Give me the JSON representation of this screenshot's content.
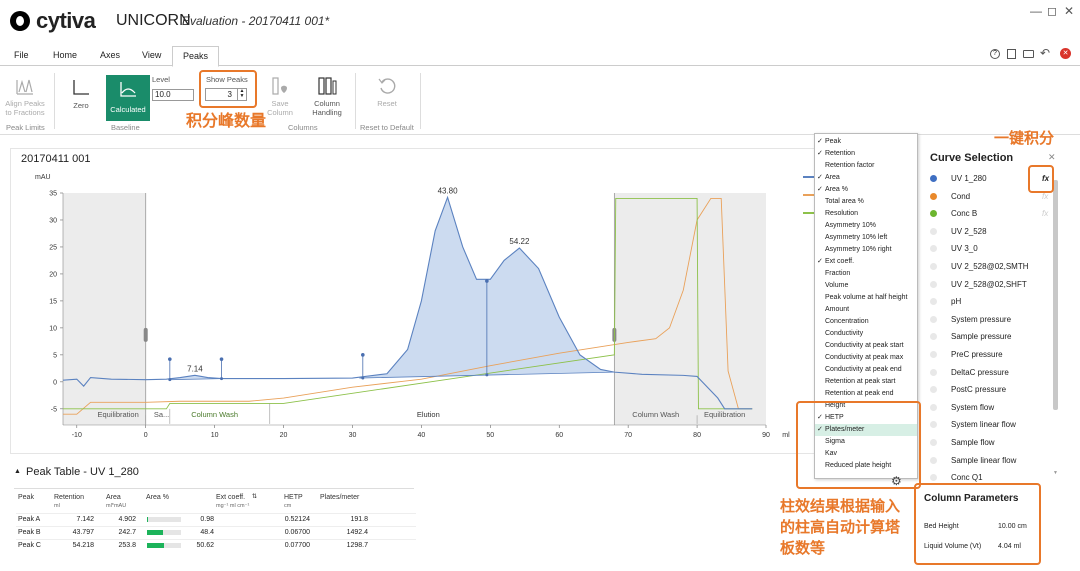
{
  "app": {
    "brand": "cytiva",
    "name": "UNICORN",
    "doc_title": "Evaluation - 20170411 001*",
    "window_buttons": [
      "—",
      "◻",
      "✕"
    ]
  },
  "menu": {
    "items": [
      "File",
      "Home",
      "Axes",
      "View",
      "Peaks"
    ],
    "active": "Peaks"
  },
  "ribbon": {
    "align_peaks": "Align Peaks to Fractions",
    "peak_limits_group": "Peak Limits",
    "zero": "Zero",
    "calculated": "Calculated",
    "level_label": "Level",
    "level_value": "10.0",
    "show_peaks_label": "Show Peaks",
    "show_peaks_value": "3",
    "baseline_group": "Baseline",
    "save_column": "Save Column",
    "column_handling": "Column Handling",
    "columns_group": "Columns",
    "reset": "Reset",
    "reset_group": "Reset to Default"
  },
  "annotations": {
    "show_peaks_note": "积分峰数量",
    "one_click": "一键积分",
    "column_efficiency_note": "柱效结果根据输入的柱高自动计算塔板数等"
  },
  "chart": {
    "title": "20170411 001",
    "ylabel": "mAU",
    "xlabel": "ml",
    "phases": [
      "Equilibration",
      "Sa...",
      "Column Wash",
      "Elution",
      "Column Wash",
      "Equilibration"
    ]
  },
  "chart_data": {
    "type": "line",
    "title": "20170411 001",
    "xlabel": "ml",
    "ylabel": "mAU",
    "xlim": [
      -12,
      90
    ],
    "ylim": [
      -8,
      35
    ],
    "x_ticks": [
      -10,
      0,
      10,
      20,
      30,
      40,
      50,
      60,
      70,
      80,
      90
    ],
    "y_ticks": [
      -5,
      0,
      5,
      10,
      15,
      20,
      25,
      30,
      35
    ],
    "peak_labels": [
      {
        "x": 7.14,
        "y": 1.2,
        "label": "7.14"
      },
      {
        "x": 43.8,
        "y": 34.2,
        "label": "43.80"
      },
      {
        "x": 54.22,
        "y": 24.8,
        "label": "54.22"
      }
    ],
    "series": [
      {
        "name": "UV 1_280",
        "color": "#5b82c0",
        "points": [
          [
            -12,
            0.3
          ],
          [
            -10,
            0.5
          ],
          [
            -9,
            -0.8
          ],
          [
            -8,
            0.8
          ],
          [
            -5,
            0.5
          ],
          [
            0,
            0.4
          ],
          [
            3,
            0.5
          ],
          [
            5,
            0.8
          ],
          [
            7.14,
            1.2
          ],
          [
            9,
            0.8
          ],
          [
            11,
            0.6
          ],
          [
            20,
            0.6
          ],
          [
            30,
            0.7
          ],
          [
            35,
            1.5
          ],
          [
            38,
            6
          ],
          [
            40,
            15
          ],
          [
            42,
            28
          ],
          [
            43.8,
            34.2
          ],
          [
            46,
            25
          ],
          [
            48,
            19
          ],
          [
            50,
            19
          ],
          [
            52,
            22.5
          ],
          [
            54.22,
            24.8
          ],
          [
            57,
            21
          ],
          [
            60,
            12
          ],
          [
            63,
            5
          ],
          [
            66,
            2.3
          ],
          [
            68,
            1.8
          ],
          [
            72,
            1.4
          ],
          [
            78,
            1.2
          ],
          [
            80,
            1.0
          ],
          [
            83,
            -3
          ],
          [
            84,
            -5
          ],
          [
            86,
            -5
          ],
          [
            88,
            -5
          ]
        ]
      },
      {
        "name": "Cond",
        "color": "#e9a15a",
        "points": [
          [
            -12,
            -6
          ],
          [
            -10,
            -6
          ],
          [
            -8,
            -3.8
          ],
          [
            -5,
            -3.8
          ],
          [
            0,
            -3.8
          ],
          [
            5,
            -3.6
          ],
          [
            15,
            -3.6
          ],
          [
            20,
            -3
          ],
          [
            30,
            -1
          ],
          [
            40,
            0.5
          ],
          [
            50,
            3
          ],
          [
            60,
            5.3
          ],
          [
            70,
            7.3
          ],
          [
            74,
            8
          ],
          [
            76,
            10
          ],
          [
            78,
            17
          ],
          [
            80,
            30
          ],
          [
            82,
            34
          ],
          [
            83.5,
            34
          ],
          [
            84.5,
            2
          ],
          [
            86,
            -5
          ],
          [
            88,
            -5
          ]
        ]
      },
      {
        "name": "Conc B",
        "color": "#8dc14a",
        "points": [
          [
            -12,
            -5
          ],
          [
            0,
            -5
          ],
          [
            3,
            -5
          ],
          [
            3.5,
            -4
          ],
          [
            18,
            -4
          ],
          [
            20,
            -4
          ],
          [
            68,
            5
          ],
          [
            68.2,
            34
          ],
          [
            80,
            34
          ],
          [
            80.2,
            -5
          ],
          [
            88,
            -5
          ]
        ]
      }
    ]
  },
  "legend": {
    "entries": [
      "UV 1_280",
      "Cond",
      "Conc B"
    ]
  },
  "peak_table": {
    "title": "Peak Table - UV 1_280",
    "columns": [
      "Peak",
      "Retention",
      "Area",
      "Area %",
      "Ext coeff.",
      "HETP",
      "Plates/meter"
    ],
    "units": [
      "",
      "ml",
      "ml*mAU",
      "",
      "mg⁻¹ ml cm⁻¹",
      "cm",
      ""
    ],
    "rows": [
      {
        "peak": "Peak A",
        "retention": "7.142",
        "area": "4.902",
        "area_pct": "0.98",
        "area_frac": 0.0098,
        "hetp": "0.52124",
        "plates": "191.8"
      },
      {
        "peak": "Peak B",
        "retention": "43.797",
        "area": "242.7",
        "area_pct": "48.4",
        "area_frac": 0.484,
        "hetp": "0.06700",
        "plates": "1492.4"
      },
      {
        "peak": "Peak C",
        "retention": "54.218",
        "area": "253.8",
        "area_pct": "50.62",
        "area_frac": 0.5062,
        "hetp": "0.07700",
        "plates": "1298.7"
      }
    ]
  },
  "dropdown": {
    "items": [
      {
        "label": "Peak",
        "checked": true
      },
      {
        "label": "Retention",
        "checked": true
      },
      {
        "label": "Retention factor",
        "checked": false
      },
      {
        "label": "Area",
        "checked": true
      },
      {
        "label": "Area %",
        "checked": true
      },
      {
        "label": "Total area %",
        "checked": false
      },
      {
        "label": "Resolution",
        "checked": false
      },
      {
        "label": "Asymmetry 10%",
        "checked": false
      },
      {
        "label": "Asymmetry 10% left",
        "checked": false
      },
      {
        "label": "Asymmetry 10% right",
        "checked": false
      },
      {
        "label": "Ext coeff.",
        "checked": true
      },
      {
        "label": "Fraction",
        "checked": false
      },
      {
        "label": "Volume",
        "checked": false
      },
      {
        "label": "Peak volume at half height",
        "checked": false
      },
      {
        "label": "Amount",
        "checked": false
      },
      {
        "label": "Concentration",
        "checked": false
      },
      {
        "label": "Conductivity",
        "checked": false
      },
      {
        "label": "Conductivity at peak start",
        "checked": false
      },
      {
        "label": "Conductivity at peak max",
        "checked": false
      },
      {
        "label": "Conductivity at peak end",
        "checked": false
      },
      {
        "label": "Retention at peak start",
        "checked": false
      },
      {
        "label": "Retention at peak end",
        "checked": false
      },
      {
        "label": "Height",
        "checked": false
      },
      {
        "label": "HETP",
        "checked": true
      },
      {
        "label": "Plates/meter",
        "checked": true,
        "selected": true
      },
      {
        "label": "Sigma",
        "checked": false
      },
      {
        "label": "Kav",
        "checked": false
      },
      {
        "label": "Reduced plate height",
        "checked": false
      }
    ]
  },
  "curve_selection": {
    "title": "Curve Selection",
    "close": "✕",
    "items": [
      {
        "label": "UV 1_280",
        "color": "#3f6fc2",
        "fx": "fx",
        "fx_active": true
      },
      {
        "label": "Cond",
        "color": "#e9892b",
        "fx": "fx"
      },
      {
        "label": "Conc B",
        "color": "#6cb52f",
        "fx": "fx"
      },
      {
        "label": "UV 2_528",
        "color": "#e8e8e8"
      },
      {
        "label": "UV 3_0",
        "color": "#e8e8e8"
      },
      {
        "label": "UV 2_528@02,SMTH",
        "color": "#e8e8e8"
      },
      {
        "label": "UV 2_528@02,SHFT",
        "color": "#e8e8e8"
      },
      {
        "label": "pH",
        "color": "#e8e8e8"
      },
      {
        "label": "System pressure",
        "color": "#e8e8e8"
      },
      {
        "label": "Sample pressure",
        "color": "#e8e8e8"
      },
      {
        "label": "PreC pressure",
        "color": "#e8e8e8"
      },
      {
        "label": "DeltaC pressure",
        "color": "#e8e8e8"
      },
      {
        "label": "PostC pressure",
        "color": "#e8e8e8"
      },
      {
        "label": "System flow",
        "color": "#e8e8e8"
      },
      {
        "label": "System linear flow",
        "color": "#e8e8e8"
      },
      {
        "label": "Sample flow",
        "color": "#e8e8e8"
      },
      {
        "label": "Sample linear flow",
        "color": "#e8e8e8"
      },
      {
        "label": "Conc Q1",
        "color": "#e8e8e8"
      }
    ]
  },
  "column_params": {
    "title": "Column Parameters",
    "bed_height_label": "Bed Height",
    "bed_height_value": "10.00 cm",
    "liquid_volume_label": "Liquid Volume (Vt)",
    "liquid_volume_value": "4.04 ml"
  }
}
